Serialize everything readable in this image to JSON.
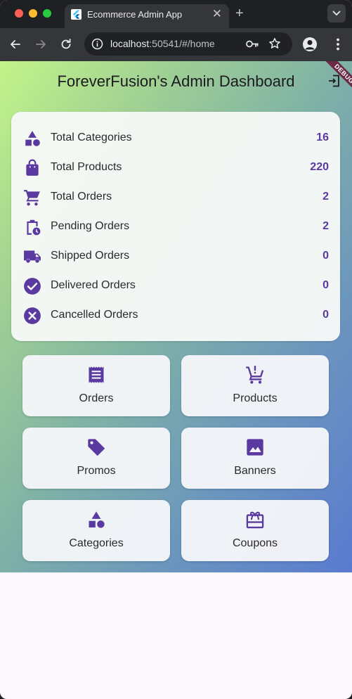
{
  "browser": {
    "tab_title": "Ecommerce Admin App",
    "tab_close_glyph": "✕",
    "new_tab_glyph": "+",
    "url_host": "localhost",
    "url_rest": ":50541/#/home",
    "icons": [
      "flutter-favicon-icon",
      "chevron-down-icon",
      "back-arrow-icon",
      "forward-arrow-icon",
      "reload-icon",
      "site-info-icon",
      "password-key-icon",
      "bookmark-star-icon",
      "profile-avatar-icon",
      "more-vert-icon"
    ]
  },
  "app": {
    "title": "ForeverFusion's Admin Dashboard",
    "debug_label": "DEBUG",
    "accent_color": "#5a3aa0",
    "stats": [
      {
        "label": "Total Categories",
        "value": "16",
        "icon": "category-icon"
      },
      {
        "label": "Total Products",
        "value": "220",
        "icon": "shopping-bag-icon"
      },
      {
        "label": "Total Orders",
        "value": "2",
        "icon": "shopping-cart-icon"
      },
      {
        "label": "Pending Orders",
        "value": "2",
        "icon": "pending-actions-icon"
      },
      {
        "label": "Shipped Orders",
        "value": "0",
        "icon": "local-shipping-icon"
      },
      {
        "label": "Delivered Orders",
        "value": "0",
        "icon": "check-circle-icon"
      },
      {
        "label": "Cancelled Orders",
        "value": "0",
        "icon": "cancel-icon"
      }
    ],
    "tiles": [
      {
        "label": "Orders",
        "icon": "receipt-icon"
      },
      {
        "label": "Products",
        "icon": "add-shopping-cart-icon"
      },
      {
        "label": "Promos",
        "icon": "sell-tag-icon"
      },
      {
        "label": "Banners",
        "icon": "image-icon"
      },
      {
        "label": "Categories",
        "icon": "category-icon"
      },
      {
        "label": "Coupons",
        "icon": "redeem-gift-icon"
      }
    ]
  }
}
